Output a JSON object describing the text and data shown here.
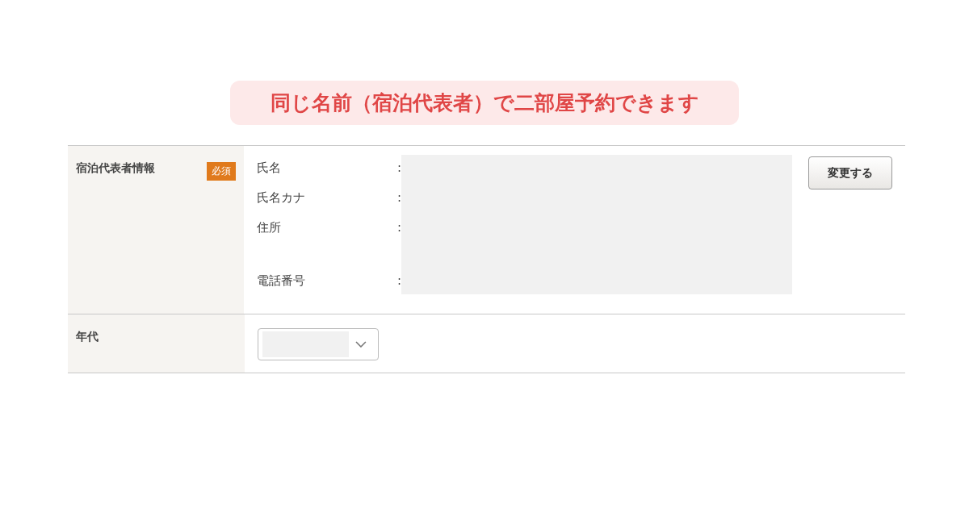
{
  "banner": {
    "text": "同じ名前（宿泊代表者）で二部屋予約できます"
  },
  "rows": [
    {
      "kind": "info",
      "label": "宿泊代表者情報",
      "badge": "必須",
      "fields": [
        {
          "label": "氏名",
          "separator": ":",
          "tall": false
        },
        {
          "label": "氏名カナ",
          "separator": ":",
          "tall": false
        },
        {
          "label": "住所",
          "separator": ":",
          "tall": true
        },
        {
          "label": "電話番号",
          "separator": ":",
          "tall": false
        }
      ],
      "button": "変更する"
    },
    {
      "kind": "select",
      "label": "年代"
    }
  ]
}
